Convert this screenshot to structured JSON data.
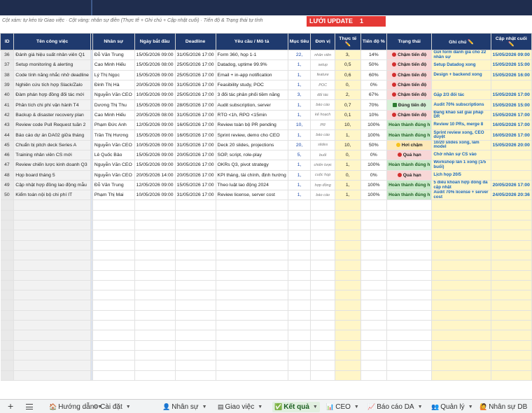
{
  "note": "Cột xám: tự kéo từ Giao việc · Cột vàng: nhân sự điền (Thực tế + Ghi chú + Cập nhật cuối) · Tiến độ & Trạng thái tự tính",
  "update_box": {
    "label": "LƯỚI UPDATE",
    "value": "1"
  },
  "columns": [
    "ID",
    "Tên công việc",
    "Nhân sự",
    "Ngày bắt đầu",
    "Deadline",
    "Yêu cầu / Mô tả",
    "Mục tiêu",
    "Đơn vị",
    "Thực tế ✏️",
    "Tiến độ %",
    "Trạng thái",
    "Ghi chú ✏️",
    "Cập nhật cuối ✏️"
  ],
  "rows": [
    {
      "id": "36",
      "name": "Đánh giá hiệu suất nhân viên Q1",
      "person": "Đỗ Văn Trung",
      "start": "15/05/2026 09:00",
      "deadline": "31/05/2026 17:00",
      "desc": "Form 360, họp 1-1",
      "target": "22,",
      "unit": "nhân viên",
      "actual": "3,",
      "pct": "14%",
      "status": "Chậm tiến độ",
      "status_kind": "late",
      "note": "Gửi form đánh giá cho 22 nhân sự",
      "updated": "15/05/2026 09:00"
    },
    {
      "id": "37",
      "name": "Setup monitoring & alerting",
      "person": "Cao Minh Hiếu",
      "start": "15/05/2026 08:00",
      "deadline": "25/05/2026 17:00",
      "desc": "Datadog, uptime 99.9%",
      "target": "1,",
      "unit": "setup",
      "actual": "0,5",
      "pct": "50%",
      "status": "Chậm tiến độ",
      "status_kind": "late",
      "note": "Setup Datadog xong",
      "updated": "15/05/2026 15:00"
    },
    {
      "id": "38",
      "name": "Code tính năng nhắc nhở deadline",
      "person": "Lý Thị Ngọc",
      "start": "15/05/2026 09:00",
      "deadline": "25/05/2026 17:00",
      "desc": "Email + in-app notification",
      "target": "1,",
      "unit": "feature",
      "actual": "0,6",
      "pct": "60%",
      "status": "Chậm tiến độ",
      "status_kind": "late",
      "note": "Design + backend xong",
      "updated": "15/05/2026 16:00"
    },
    {
      "id": "39",
      "name": "Nghiên cứu tích hợp Slack/Zalo",
      "person": "Đinh Thị Hà",
      "start": "20/05/2026 09:00",
      "deadline": "31/05/2026 17:00",
      "desc": "Feasibility study, POC",
      "target": "1,",
      "unit": "POC",
      "actual": "0,",
      "pct": "0%",
      "status": "Chậm tiến độ",
      "status_kind": "late",
      "note": "",
      "updated": ""
    },
    {
      "id": "40",
      "name": "Đàm phán hợp đồng đối tác mới",
      "person": "Nguyễn Văn CEO",
      "start": "10/05/2026 09:00",
      "deadline": "25/05/2026 17:00",
      "desc": "3 đối tác phân phối tiềm năng",
      "target": "3,",
      "unit": "đối tác",
      "actual": "2,",
      "pct": "67%",
      "status": "Chậm tiến độ",
      "status_kind": "late",
      "note": "Gặp 2/3 đối tác",
      "updated": "15/05/2026 17:00"
    },
    {
      "id": "41",
      "name": "Phân tích chi phí vận hành T4",
      "person": "Dương Thị Thu",
      "start": "15/05/2026 09:00",
      "deadline": "28/05/2026 17:00",
      "desc": "Audit subscription, server",
      "target": "1,",
      "unit": "báo cáo",
      "actual": "0,7",
      "pct": "70%",
      "status": "Đúng tiến độ",
      "status_kind": "ok",
      "note": "Audit 70% subscriptions",
      "updated": "15/05/2026 15:00"
    },
    {
      "id": "42",
      "name": "Backup & disaster recovery plan",
      "person": "Cao Minh Hiếu",
      "start": "20/05/2026 08:00",
      "deadline": "31/05/2026 17:00",
      "desc": "RTO <1h, RPO <15min",
      "target": "1,",
      "unit": "kế hoạch",
      "actual": "0,1",
      "pct": "10%",
      "status": "Chậm tiến độ",
      "status_kind": "late",
      "note": "Đang khảo sát giải pháp DR",
      "updated": "15/05/2026 17:00"
    },
    {
      "id": "43",
      "name": "Review code Pull Request tuần 2",
      "person": "Phạm Đức Anh",
      "start": "12/05/2026 09:00",
      "deadline": "16/05/2026 17:00",
      "desc": "Review toàn bộ PR pending",
      "target": "10,",
      "unit": "PR",
      "actual": "10,",
      "pct": "100%",
      "status": "Hoàn thành đúng h",
      "status_kind": "done",
      "note": "Review 10 PRs, merge 8",
      "updated": "16/05/2026 17:00"
    },
    {
      "id": "44",
      "name": "Báo cáo dự án DA02 giữa tháng",
      "person": "Trần Thị Hương",
      "start": "15/05/2026 09:00",
      "deadline": "16/05/2026 17:00",
      "desc": "Sprint review, demo cho CEO",
      "target": "1,",
      "unit": "báo cáo",
      "actual": "1,",
      "pct": "100%",
      "status": "Hoàn thành đúng h",
      "status_kind": "done",
      "note": "Sprint review xong, CEO duyệt",
      "updated": "16/05/2026 17:00"
    },
    {
      "id": "45",
      "name": "Chuẩn bị pitch deck Series A",
      "person": "Nguyễn Văn CEO",
      "start": "10/05/2026 09:00",
      "deadline": "31/05/2026 17:00",
      "desc": "Deck 20 slides, projections",
      "target": "20,",
      "unit": "slides",
      "actual": "10,",
      "pct": "50%",
      "status": "Hơi chậm",
      "status_kind": "warn",
      "note": "10/20 slides xong, làm model",
      "updated": "15/05/2026 20:00"
    },
    {
      "id": "46",
      "name": "Training nhân viên CS mới",
      "person": "Lê Quốc Bảo",
      "start": "15/05/2026 09:00",
      "deadline": "20/05/2026 17:00",
      "desc": "SOP, script, role-play",
      "target": "5,",
      "unit": "buổi",
      "actual": "0,",
      "pct": "0%",
      "status": "Quá hạn",
      "status_kind": "over",
      "note": "Chờ nhân sự CS vào",
      "updated": ""
    },
    {
      "id": "47",
      "name": "Review chiến lược kinh doanh Q3",
      "person": "Nguyễn Văn CEO",
      "start": "15/05/2026 09:00",
      "deadline": "30/05/2026 17:00",
      "desc": "OKRs Q3, pivot strategy",
      "target": "1,",
      "unit": "chiến lược",
      "actual": "1,",
      "pct": "100%",
      "status": "Hoàn thành đúng h",
      "status_kind": "done",
      "note": "Workshop lần 1 xong (1/5 buổi)",
      "updated": ""
    },
    {
      "id": "48",
      "name": "Họp board tháng 5",
      "person": "Nguyễn Văn CEO",
      "start": "20/05/2026 14:00",
      "deadline": "20/05/2026 17:00",
      "desc": "KPI tháng, tài chính, định hướng",
      "target": "1,",
      "unit": "cuộc họp",
      "actual": "0,",
      "pct": "0%",
      "status": "Quá hạn",
      "status_kind": "over",
      "note": "Lịch họp 20/5",
      "updated": ""
    },
    {
      "id": "49",
      "name": "Cập nhật hợp đồng lao động mẫu",
      "person": "Đỗ Văn Trung",
      "start": "12/05/2026 09:00",
      "deadline": "15/05/2026 17:00",
      "desc": "Theo luật lao động 2024",
      "target": "1,",
      "unit": "hợp đồng",
      "actual": "1,",
      "pct": "100%",
      "status": "Hoàn thành đúng h",
      "status_kind": "done",
      "note": "5 điều khoản hợp đồng đã cập nhật",
      "updated": "20/05/2026 17:00"
    },
    {
      "id": "50",
      "name": "Kiểm toán nội bộ chi phí IT",
      "person": "Phạm Thị Mai",
      "start": "10/05/2026 09:00",
      "deadline": "31/05/2026 17:00",
      "desc": "Review license, server cost",
      "target": "1,",
      "unit": "báo cáo",
      "actual": "1,",
      "pct": "100%",
      "status": "Hoàn thành đúng h",
      "status_kind": "done",
      "note": "Audit 70% license + server cost",
      "updated": "24/05/2026 20:36"
    }
  ],
  "tabs": [
    {
      "label": "Hướng dẫn",
      "icon": "home-icon",
      "glyph": "🏠",
      "active": false
    },
    {
      "label": "Cài đặt",
      "icon": "gear-icon",
      "glyph": "⚙",
      "active": false
    },
    {
      "label": "Nhân sự",
      "icon": "person-icon",
      "glyph": "👤",
      "active": false
    },
    {
      "label": "Giao việc",
      "icon": "clipboard-icon",
      "glyph": "▤",
      "active": false
    },
    {
      "label": "Kết quả",
      "icon": "check-icon",
      "glyph": "✅",
      "active": true
    },
    {
      "label": "CEO",
      "icon": "chart-icon",
      "glyph": "📊",
      "active": false
    },
    {
      "label": "Báo cáo DA",
      "icon": "chart-line-icon",
      "glyph": "📈",
      "active": false
    },
    {
      "label": "Quản lý",
      "icon": "people-icon",
      "glyph": "👥",
      "active": false
    },
    {
      "label": "Nhân sự DB",
      "icon": "person-db-icon",
      "glyph": "🙋",
      "active": false
    }
  ]
}
